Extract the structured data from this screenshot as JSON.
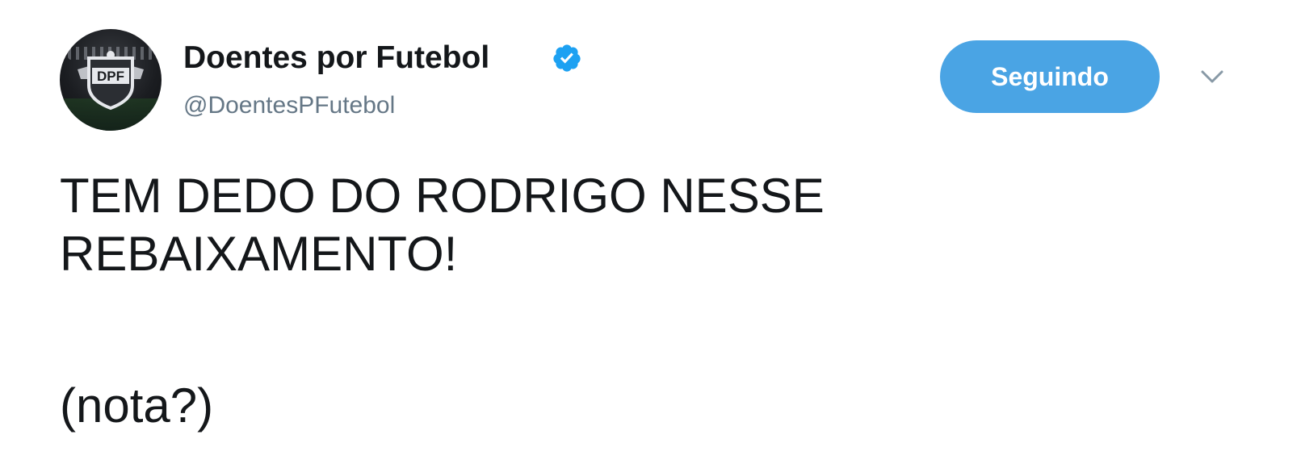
{
  "tweet": {
    "author": {
      "name": "Doentes por Futebol",
      "handle": "@DoentesPFutebol",
      "avatar_logo": "DPF",
      "verified": true,
      "verified_badge_color": "#1da1f2"
    },
    "follow_button": {
      "label": "Seguindo",
      "color": "#4aa4e4"
    },
    "menu_icon": "chevron-down-icon",
    "text_lines": [
      "TEM DEDO DO RODRIGO NESSE",
      "REBAIXAMENTO!",
      "(nota?)"
    ]
  }
}
